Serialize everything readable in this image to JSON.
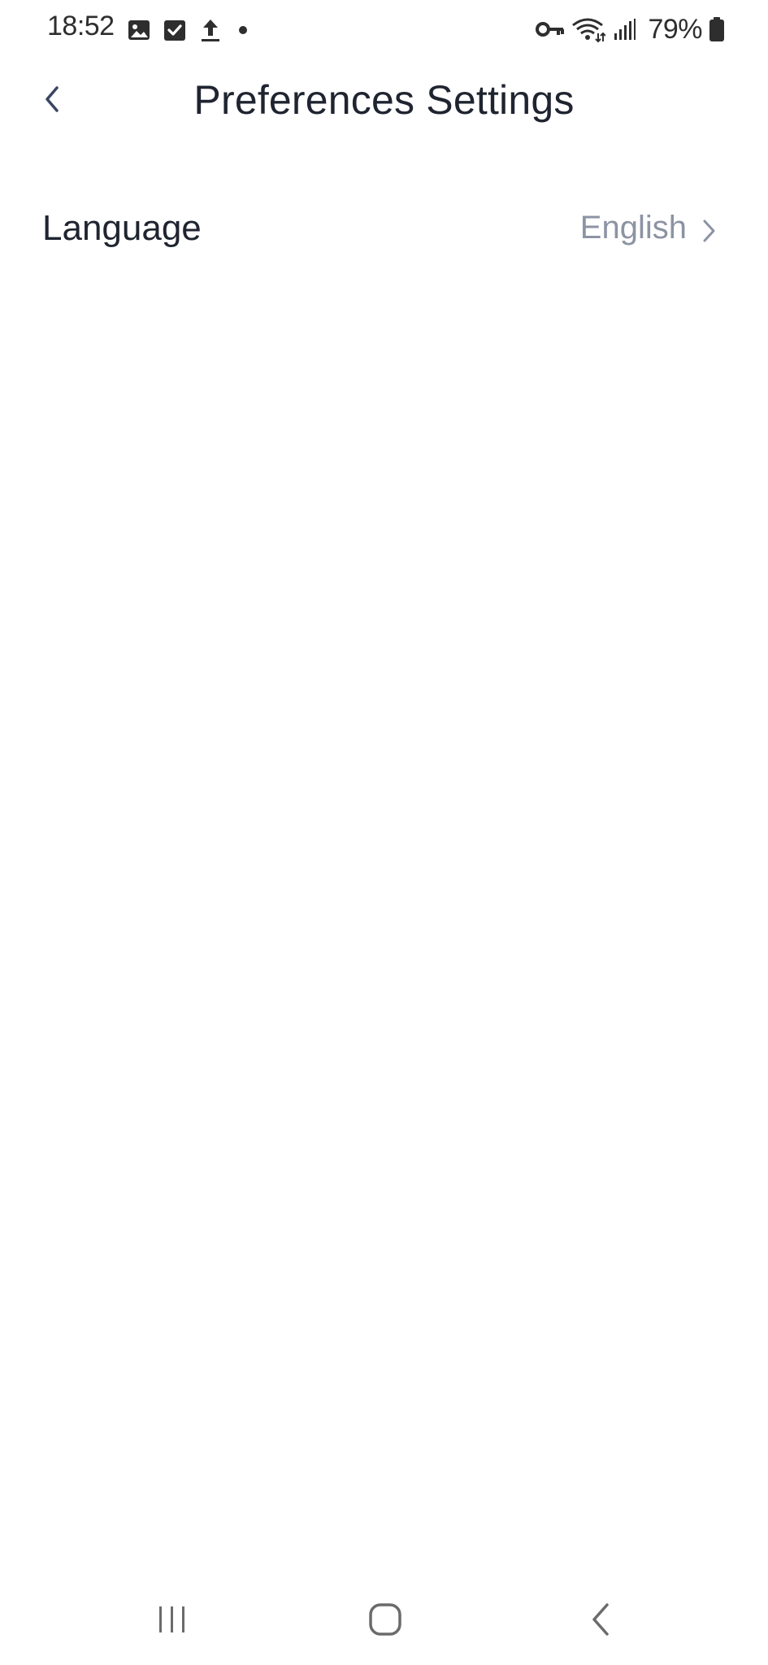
{
  "status_bar": {
    "time": "18:52",
    "left_icons": [
      "image-icon",
      "checkbox-icon",
      "upload-icon",
      "dot-icon"
    ],
    "right_icons": [
      "vpn-key-icon",
      "wifi-icon",
      "signal-icon",
      "battery-icon"
    ],
    "battery_percent": "79%"
  },
  "header": {
    "back_icon": "chevron-left-icon",
    "title": "Preferences Settings"
  },
  "settings": {
    "items": [
      {
        "label": "Language",
        "value": "English",
        "icon": "chevron-right-icon"
      }
    ]
  },
  "nav_bar": {
    "buttons": [
      "recents-icon",
      "home-icon",
      "back-icon"
    ]
  },
  "colors": {
    "background": "#ffffff",
    "title_text": "#1f2430",
    "secondary_text": "#8c93a3",
    "status_text": "#2e2e2e",
    "back_chevron": "#3a4663",
    "nav_icons": "#6b6b6b"
  }
}
